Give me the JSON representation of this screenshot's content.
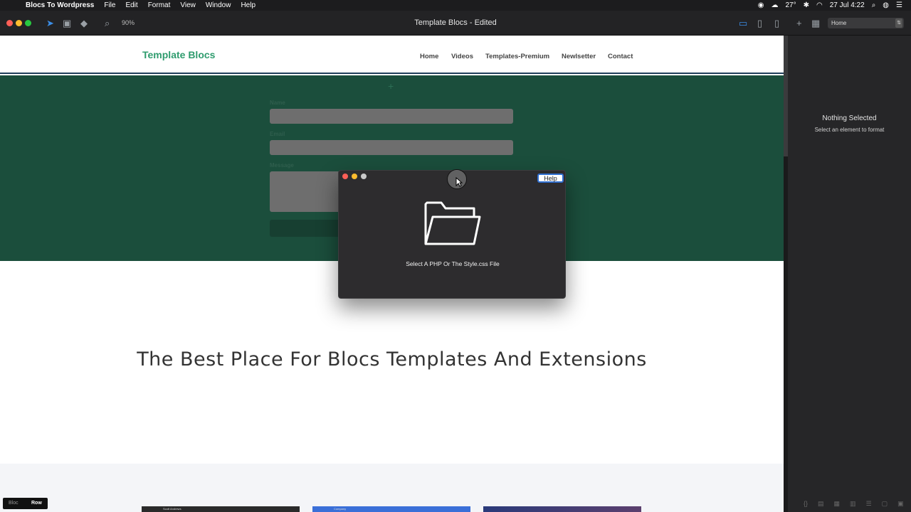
{
  "menubar": {
    "app_name": "Blocs To Wordpress",
    "items": [
      "File",
      "Edit",
      "Format",
      "View",
      "Window",
      "Help"
    ],
    "temperature": "27°",
    "datetime": "27 Jul  4:22"
  },
  "toolbar": {
    "zoom": "90%",
    "document_title": "Template Blocs - Edited",
    "page_select": "Home"
  },
  "site": {
    "brand": "Template Blocs",
    "nav": [
      "Home",
      "Videos",
      "Templates-Premium",
      "Newlsetter",
      "Contact"
    ],
    "form": {
      "name_label": "Name",
      "email_label": "Email",
      "message_label": "Message"
    },
    "hero_title": "The Best Place For Blocs Templates And Extensions",
    "thumbs": [
      "Scott Andrews",
      "Company",
      ""
    ]
  },
  "bottom_bar": {
    "bloc_label": "Bloc",
    "row_label": "Row"
  },
  "inspector": {
    "title": "Nothing Selected",
    "subtitle": "Select an element to format"
  },
  "dialog": {
    "help_label": "Help",
    "message": "Select A PHP Or The Style.css File",
    "icon": "folder-open-icon"
  },
  "colors": {
    "brand_green": "#2f9c6e",
    "section_green": "#1b4e3c",
    "dialog_bg": "#2d2c2e",
    "help_border": "#2f6fd1"
  }
}
